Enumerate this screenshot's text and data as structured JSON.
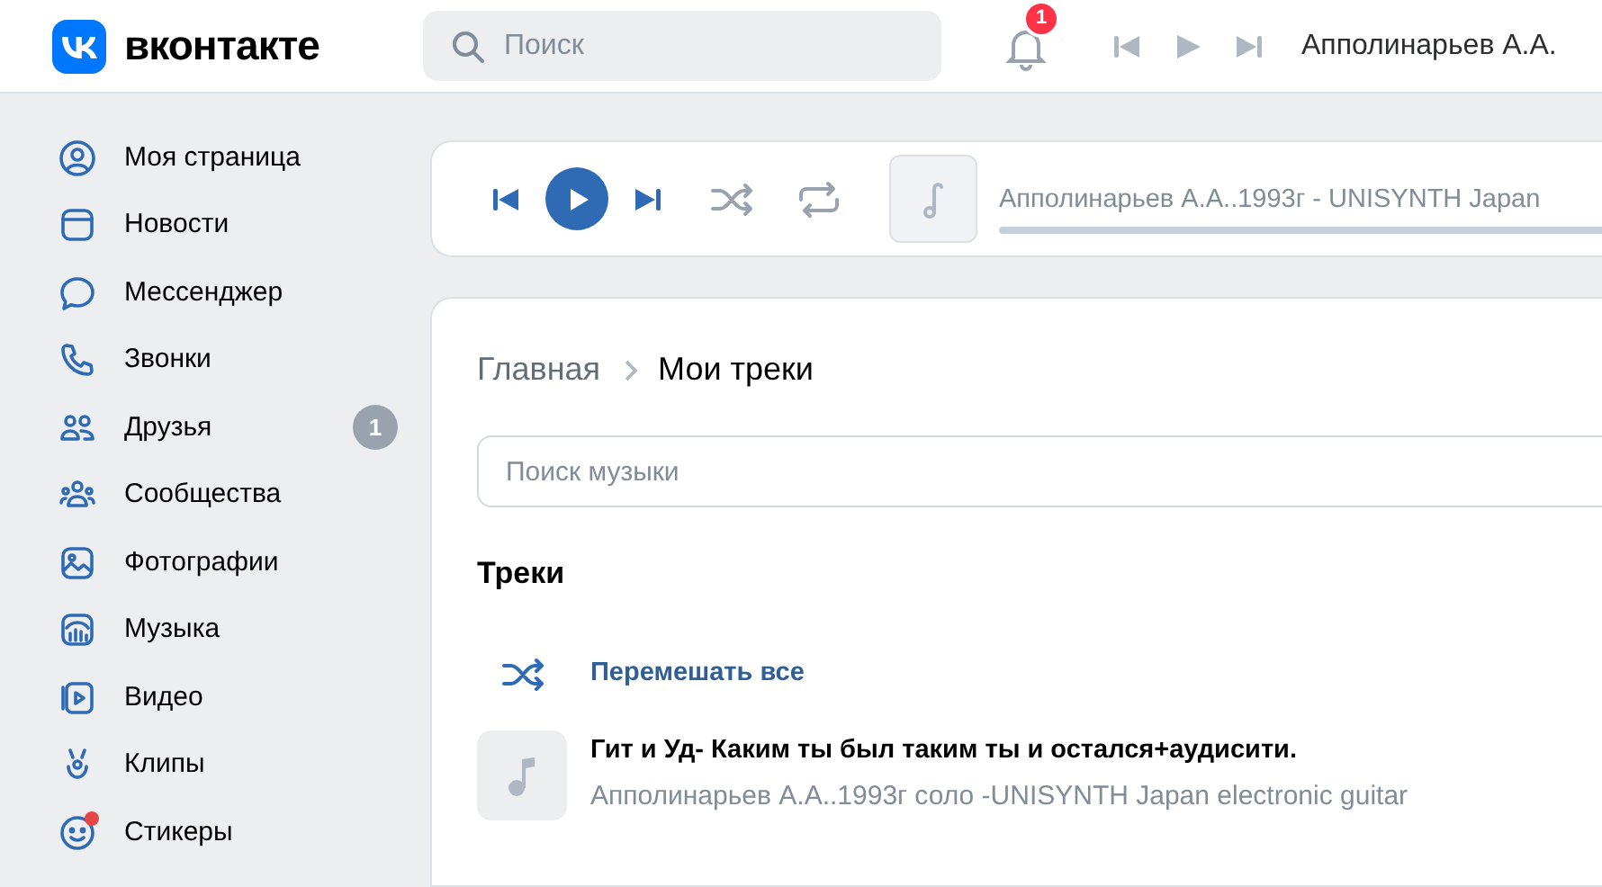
{
  "header": {
    "logo_text": "вконтакте",
    "search": {
      "placeholder": "Поиск"
    },
    "notifications": {
      "count": "1"
    },
    "now_playing": "Апполинарьев А.А."
  },
  "sidebar": {
    "items": [
      {
        "label": "Моя страница",
        "dot": false
      },
      {
        "label": "Новости",
        "dot": false
      },
      {
        "label": "Мессенджер",
        "dot": false
      },
      {
        "label": "Звонки",
        "dot": false
      },
      {
        "label": "Друзья",
        "badge": "1",
        "dot": false
      },
      {
        "label": "Сообщества",
        "dot": false
      },
      {
        "label": "Фотографии",
        "dot": false
      },
      {
        "label": "Музыка",
        "dot": false
      },
      {
        "label": "Видео",
        "dot": false
      },
      {
        "label": "Клипы",
        "dot": false
      },
      {
        "label": "Стикеры",
        "dot": true
      }
    ]
  },
  "player": {
    "track": "Апполинарьев А.А..1993г - UNISYNTH Japan",
    "progress": {
      "level": 0
    }
  },
  "breadcrumbs": [
    "Главная",
    "Мои треки"
  ],
  "music_search": {
    "placeholder": "Поиск музыки"
  },
  "section_title": "Треки",
  "shuffle_all": "Перемешать все",
  "tracks": [
    {
      "title": "Гит и Уд- Каким ты был таким ты и остался+аудисити.",
      "artist": "Апполинарьев А.А..1993г соло -UNISYNTH Japan electronic guitar"
    }
  ]
}
